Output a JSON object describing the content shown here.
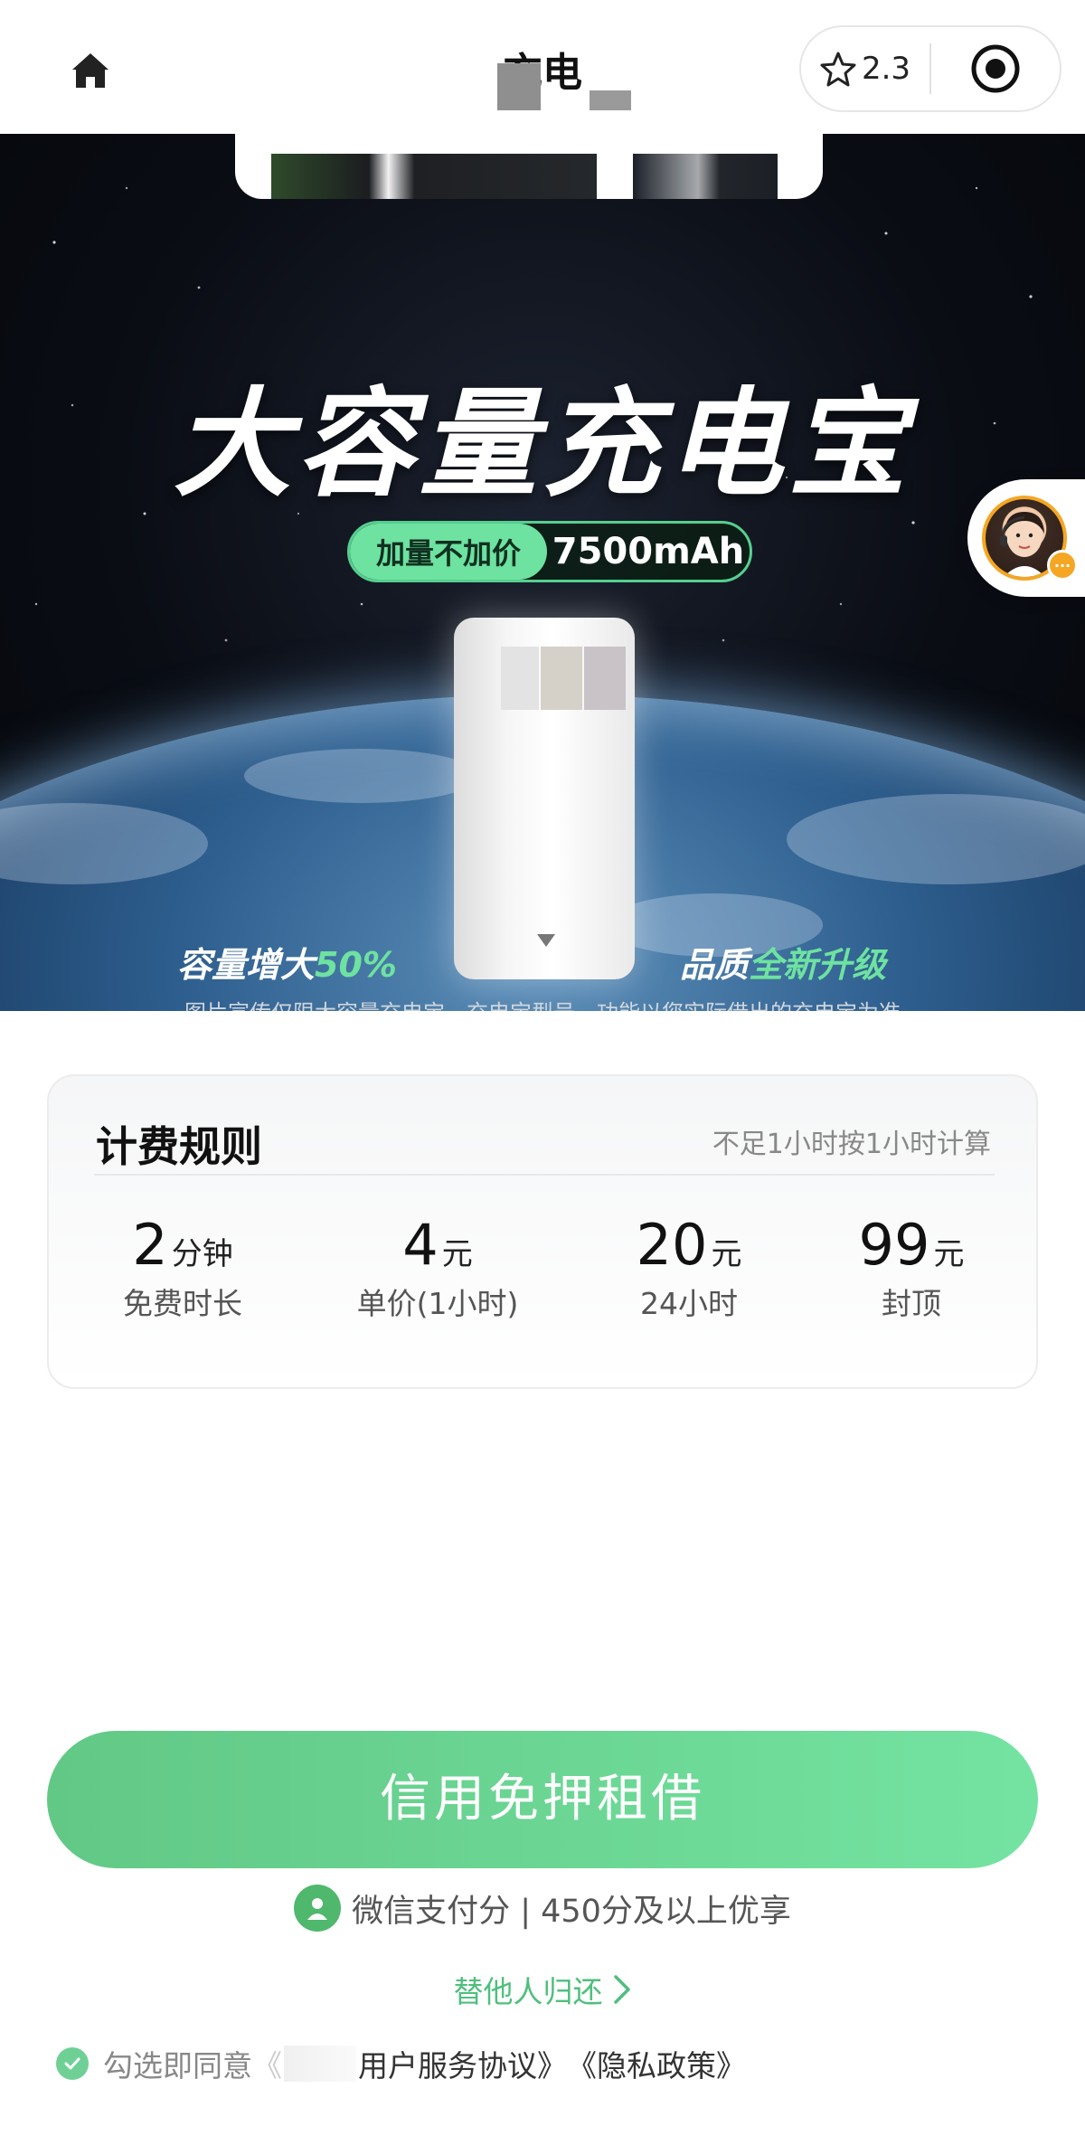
{
  "nav": {
    "title": "充电",
    "rating": "2.3"
  },
  "banner": {
    "headline": "大容量充电宝",
    "pill_tag": "加量不加价",
    "pill_capacity": "7500mAh",
    "promo_left_prefix": "容量增大",
    "promo_left_highlight": "50%",
    "promo_right_prefix": "品质",
    "promo_right_highlight": "全新升级",
    "disclaimer": "图片宣传仅限大容量充电宝，充电宝型号、功能以您实际借出的充电宝为准"
  },
  "service": {
    "badge": "···"
  },
  "pricing": {
    "title": "计费规则",
    "note": "不足1小时按1小时计算",
    "items": [
      {
        "value": "2",
        "unit": "分钟",
        "label": "免费时长"
      },
      {
        "value": "4",
        "unit": "元",
        "label": "单价(1小时)"
      },
      {
        "value": "20",
        "unit": "元",
        "label": "24小时"
      },
      {
        "value": "99",
        "unit": "元",
        "label": "封顶"
      }
    ]
  },
  "actions": {
    "rent_button": "信用免押租借",
    "wxpay_text": "微信支付分 | 450分及以上优享",
    "return_link": "替他人归还",
    "agree_prefix": "勾选即同意",
    "agree_left_bracket": "《",
    "agree_user_agreement": "用户服务协议》",
    "agree_privacy": "《隐私政策》"
  },
  "colors": {
    "accent_green": "#6ee2a0",
    "button_green": "#62c886",
    "link_green": "#4fbf7d",
    "service_orange": "#f5a623"
  },
  "icons": {
    "home": "home-icon",
    "favorite": "star-icon",
    "close": "target-icon",
    "wxpay": "wechat-pay-score-icon",
    "arrow": "chevron-right-icon",
    "check": "check-circle-icon"
  }
}
